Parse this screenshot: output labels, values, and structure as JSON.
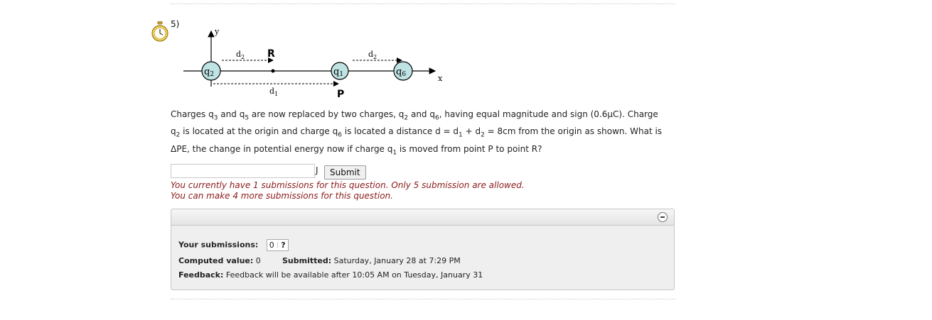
{
  "question": {
    "number": "5)",
    "text_parts": {
      "p1": "Charges q",
      "s1": "3",
      "p2": " and q",
      "s2": "5",
      "p3": " are now replaced by two charges, q",
      "s3": "2",
      "p4": " and q",
      "s4": "6",
      "p5": ", having equal magnitude and sign (0.6μC). Charge q",
      "s5": "2",
      "p6": " is located at the origin and charge q",
      "s6": "6",
      "p7": " is located a distance d = d",
      "s7": "1",
      "p8": " + d",
      "s8": "2",
      "p9": " = 8cm from the origin as shown. What is ΔPE, the change in potential energy now if charge q",
      "s9": "1",
      "p10": " is moved from point P to point R?"
    }
  },
  "diagram": {
    "y_axis": "y",
    "x_axis": "x",
    "charge_q2": "q",
    "charge_q2_sub": "2",
    "charge_q1": "q",
    "charge_q1_sub": "1",
    "charge_q6": "q",
    "charge_q6_sub": "6",
    "point_r": "R",
    "point_p": "P",
    "d2_left": "d",
    "d2_left_sub": "2",
    "d2_right": "d",
    "d2_right_sub": "2",
    "d1": "d",
    "d1_sub": "1",
    "charge_fill": "#bfe3e3"
  },
  "answer": {
    "value": "",
    "placeholder": "",
    "unit": "J",
    "submit_label": "Submit"
  },
  "messages": {
    "line1": "You currently have 1 submissions for this question. Only 5 submission are allowed.",
    "line2": "You can make 4 more submissions for this question."
  },
  "panel": {
    "your_submissions_label": "Your submissions:",
    "submission_value": "0",
    "submission_status": "?",
    "computed_label": "Computed value:",
    "computed_value": "0",
    "submitted_label": "Submitted:",
    "submitted_value": "Saturday, January 28 at 7:29 PM",
    "feedback_label": "Feedback:",
    "feedback_value": "Feedback will be available after 10:05 AM on Tuesday, January 31"
  },
  "colors": {
    "message": "#8b1a1a",
    "panel_bg": "#efefef"
  }
}
